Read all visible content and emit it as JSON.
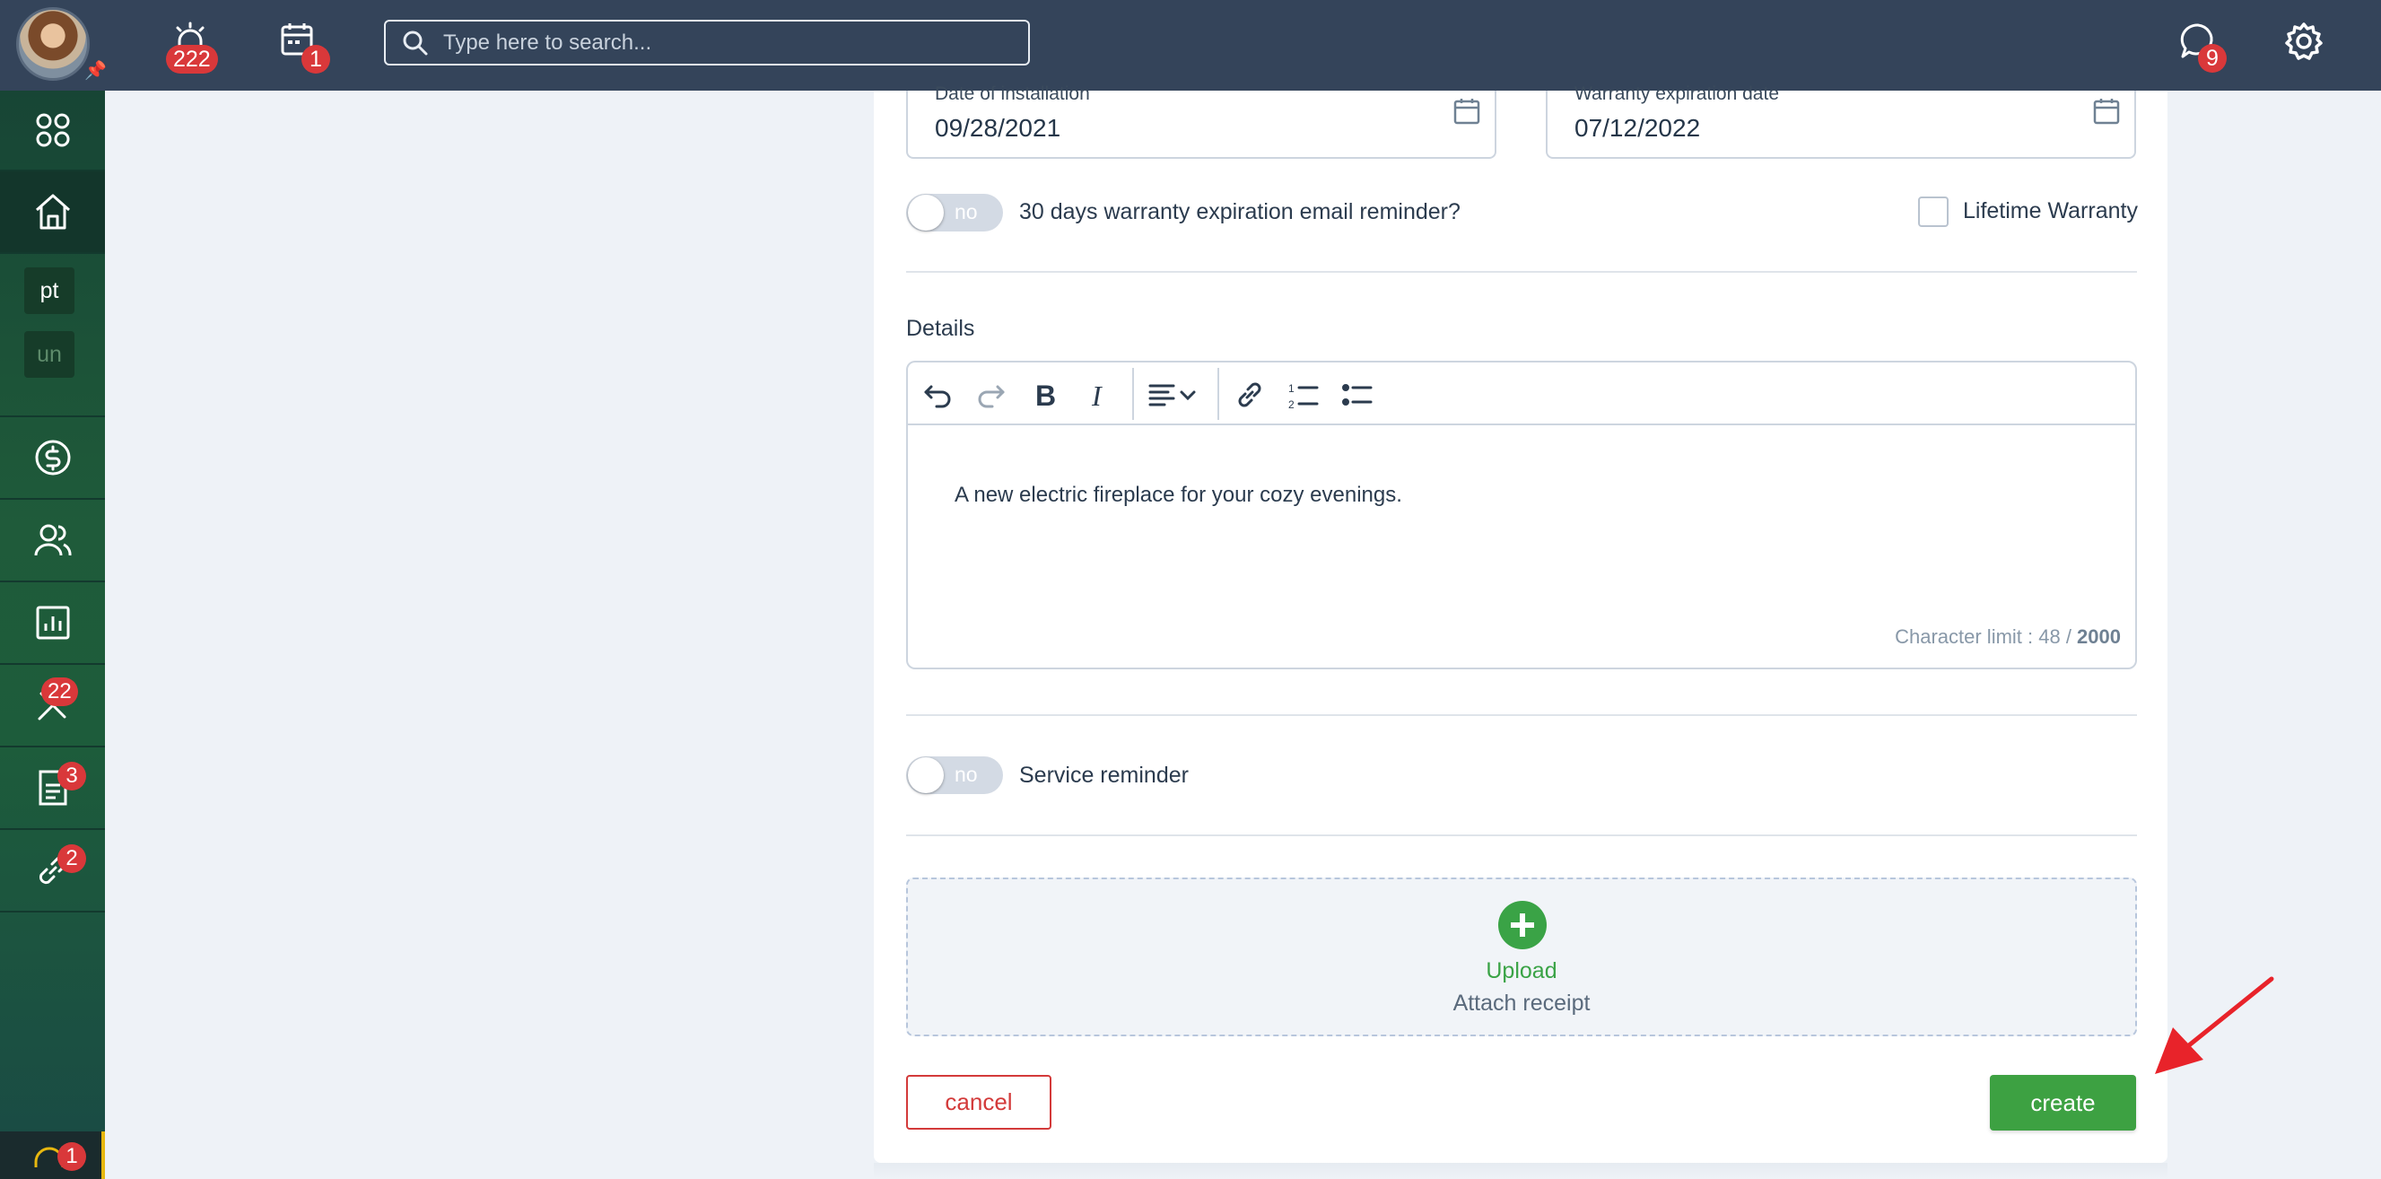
{
  "topbar": {
    "avatar_alt": "User avatar",
    "alarm_badge": "222",
    "calendar_badge": "1",
    "search_placeholder": "Type here to search...",
    "chat_badge": "9"
  },
  "sidebar": {
    "tags": [
      "pt",
      "un"
    ],
    "tools_badge": "22",
    "documents_badge": "3",
    "links_badge": "2",
    "support_badge": "1"
  },
  "form": {
    "installation_date": {
      "label": "Date of installation",
      "value": "09/28/2021"
    },
    "warranty_date": {
      "label": "Warranty expiration date",
      "value": "07/12/2022"
    },
    "warranty_reminder": {
      "toggle": "no",
      "label": "30 days warranty expiration email reminder?"
    },
    "lifetime_warranty_label": "Lifetime Warranty",
    "details_title": "Details",
    "details_text": "A new electric fireplace for your cozy evenings.",
    "char_limit_prefix": "Character limit : 48 / ",
    "char_limit_max": "2000",
    "service_reminder": {
      "toggle": "no",
      "label": "Service reminder"
    },
    "upload_label": "Upload",
    "upload_sub": "Attach receipt",
    "cancel_label": "cancel",
    "create_label": "create"
  },
  "colors": {
    "topbar": "#34445a",
    "sidebar": "#1f5b3a",
    "accent_green": "#3da142",
    "danger_red": "#d33a3a",
    "badge_red": "#d9383a",
    "annotation_arrow": "#e8232a"
  }
}
